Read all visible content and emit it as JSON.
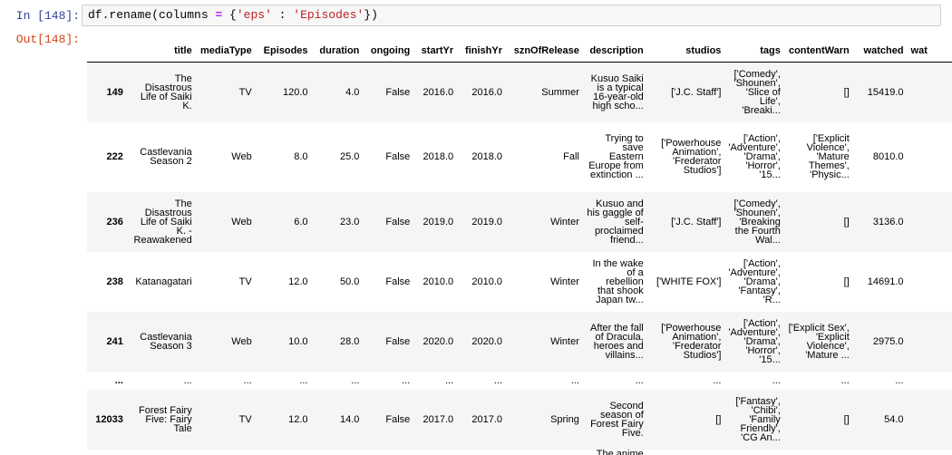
{
  "input_prompt": "In [148]:",
  "output_prompt": "Out[148]:",
  "code": {
    "prefix": "df.rename(columns ",
    "eq": "=",
    "brace_open": " {",
    "key": "'eps'",
    "colon": " : ",
    "value": "'Episodes'",
    "suffix": "})"
  },
  "table": {
    "columns": [
      "",
      "title",
      "mediaType",
      "Episodes",
      "duration",
      "ongoing",
      "startYr",
      "finishYr",
      "sznOfRelease",
      "description",
      "studios",
      "tags",
      "contentWarn",
      "watched",
      "wat"
    ],
    "rows": [
      [
        "149",
        "The Disastrous Life of Saiki K.",
        "TV",
        "120.0",
        "4.0",
        "False",
        "2016.0",
        "2016.0",
        "Summer",
        "Kusuo Saiki is a typical 16-year-old high scho...",
        "['J.C. Staff']",
        "['Comedy', 'Shounen', 'Slice of Life', 'Breaki...",
        "[]",
        "15419.0",
        ""
      ],
      [
        "222",
        "Castlevania Season 2",
        "Web",
        "8.0",
        "25.0",
        "False",
        "2018.0",
        "2018.0",
        "Fall",
        "Trying to save Eastern Europe from extinction ...",
        "['Powerhouse Animation', 'Frederator Studios']",
        "['Action', 'Adventure', 'Drama', 'Horror', '15...",
        "['Explicit Violence', 'Mature Themes', 'Physic...",
        "8010.0",
        ""
      ],
      [
        "236",
        "The Disastrous Life of Saiki K. - Reawakened",
        "Web",
        "6.0",
        "23.0",
        "False",
        "2019.0",
        "2019.0",
        "Winter",
        "Kusuo and his gaggle of self-proclaimed friend...",
        "['J.C. Staff']",
        "['Comedy', 'Shounen', 'Breaking the Fourth Wal...",
        "[]",
        "3136.0",
        ""
      ],
      [
        "238",
        "Katanagatari",
        "TV",
        "12.0",
        "50.0",
        "False",
        "2010.0",
        "2010.0",
        "Winter",
        "In the wake of a rebellion that shook Japan tw...",
        "['WHITE FOX']",
        "['Action', 'Adventure', 'Drama', 'Fantasy', 'R...",
        "[]",
        "14691.0",
        ""
      ],
      [
        "241",
        "Castlevania Season 3",
        "Web",
        "10.0",
        "28.0",
        "False",
        "2020.0",
        "2020.0",
        "Winter",
        "After the fall of Dracula, heroes and villains...",
        "['Powerhouse Animation', 'Frederator Studios']",
        "['Action', 'Adventure', 'Drama', 'Horror', '15...",
        "['Explicit Sex', 'Explicit Violence', 'Mature ...",
        "2975.0",
        ""
      ],
      [
        "...",
        "...",
        "...",
        "...",
        "...",
        "...",
        "...",
        "...",
        "...",
        "...",
        "...",
        "...",
        "...",
        "...",
        ""
      ],
      [
        "12033",
        "Forest Fairy Five: Fairy Tale",
        "TV",
        "12.0",
        "14.0",
        "False",
        "2017.0",
        "2017.0",
        "Spring",
        "Second season of Forest Fairy Five.",
        "[]",
        "['Fantasy', 'Chibi', 'Family Friendly', 'CG An...",
        "[]",
        "54.0",
        ""
      ],
      [
        "",
        "",
        "",
        "",
        "",
        "",
        "",
        "",
        "",
        "The anime",
        "",
        "",
        "",
        "",
        ""
      ]
    ]
  }
}
